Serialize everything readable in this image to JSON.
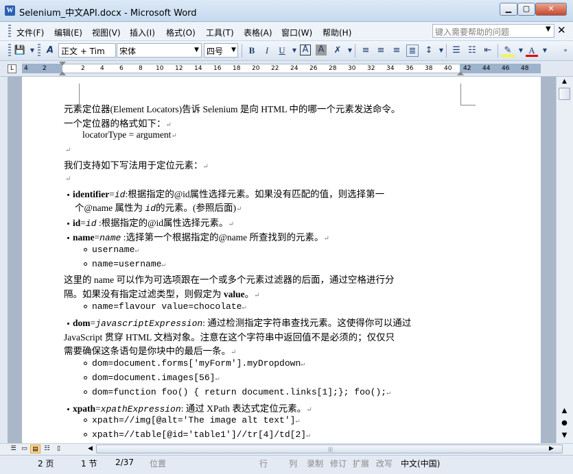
{
  "window": {
    "title": "Selenium_中文API.docx - Microsoft Word",
    "app_icon_label": "W"
  },
  "menu": {
    "items": [
      "文件(F)",
      "编辑(E)",
      "视图(V)",
      "插入(I)",
      "格式(O)",
      "工具(T)",
      "表格(A)",
      "窗口(W)",
      "帮助(H)"
    ],
    "help_placeholder": "键入需要帮助的问题"
  },
  "toolbar": {
    "style_value": "正文 + Tim",
    "font_value": "宋体",
    "size_value": "四号",
    "bold_label": "B",
    "italic_label": "I",
    "underline_label": "U",
    "char_border_label": "A",
    "char_shading_label": "A",
    "font_color_label": "A"
  },
  "ruler": {
    "labels": [
      "4",
      "2",
      "2",
      "4",
      "6",
      "8",
      "10",
      "12",
      "14",
      "16",
      "18",
      "20",
      "22",
      "24",
      "26",
      "28",
      "30",
      "32",
      "34",
      "36",
      "38",
      "40",
      "42",
      "44",
      "46",
      "48"
    ]
  },
  "document": {
    "lines": {
      "l1": "元素定位器(Element Locators)告诉 Selenium 是向 HTML 中的哪一个元素发送命令。",
      "l2": "一个定位器的格式如下：",
      "l3": "locatorType = argument",
      "l5": "我们支持如下写法用于定位元素：",
      "id1_key": "identifier",
      "id1_eq": "=",
      "id1_arg": "id",
      "id1_rest": ":根据指定的@id属性选择元素。如果没有匹配的值，则选择第一",
      "id1_cont_a": "个@name 属性为 ",
      "id1_cont_arg": "id",
      "id1_cont_b": "的元素。(参照后面)",
      "id2_key": "id",
      "id2_eq": "=",
      "id2_arg": "id",
      "id2_rest": " :根据指定的@id属性选择元素。",
      "name_key": "name",
      "name_eq": "=",
      "name_arg": "name",
      "name_rest": " :选择第一个根据指定的@name 所查找到的元素。",
      "name_ex1": "username",
      "name_ex2": "name=username",
      "filter1": "这里的 name 可以作为可选项跟在一个或多个元素过滤器的后面，通过空格进行分",
      "filter2a": "隔。如果没有指定过滤类型，则假定为 ",
      "filter2b": "value",
      "filter2c": "。",
      "filter_ex": "name=flavour value=chocolate",
      "dom_key": "dom",
      "dom_eq": "=",
      "dom_arg": "javascriptExpression",
      "dom_rest": ": 通过检测指定字符串查找元素。这使得你可以通过",
      "dom2": "JavaScript 贯穿 HTML 文档对象。注意在这个字符串中返回值不是必须的；仅仅只",
      "dom3": "需要确保这条语句是你块中的最后一条。",
      "dom_ex1": "dom=document.forms['myForm'].myDropdown",
      "dom_ex2": "dom=document.images[56]",
      "dom_ex3": "dom=function foo() { return document.links[1];}; foo();",
      "xpath_key": "xpath",
      "xpath_eq": "=",
      "xpath_arg": "xpathExpression",
      "xpath_rest": ": 通过 XPath 表达式定位元素。",
      "xpath_ex1": "xpath=//img[@alt='The image alt text']",
      "xpath_ex2": "xpath=//table[@id='table1']//tr[4]/td[2]"
    },
    "para_mark": "↵"
  },
  "status": {
    "page": "2 页",
    "section": "1 节",
    "page_of": "2/37",
    "position": "位置",
    "row": "行",
    "col": "列",
    "rec": "录制",
    "trk": "修订",
    "ext": "扩展",
    "ovr": "改写",
    "lang": "中文(中国)"
  }
}
